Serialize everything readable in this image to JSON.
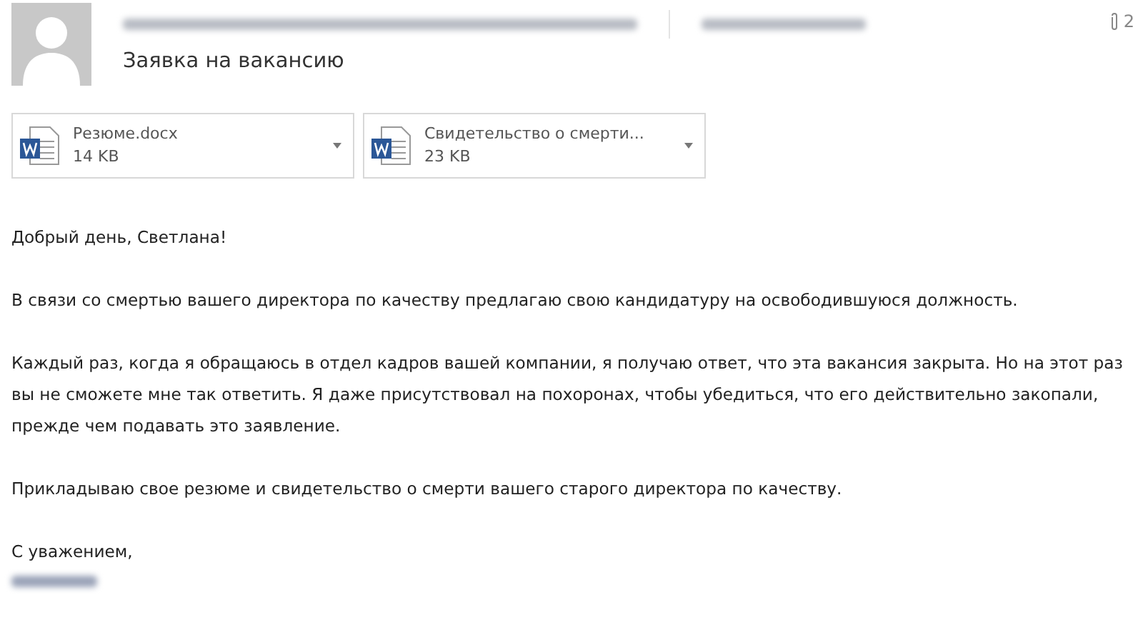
{
  "header": {
    "subject": "Заявка на вакансию",
    "attachment_count": "2"
  },
  "attachments": [
    {
      "name": "Резюме.docx",
      "size": "14 KB"
    },
    {
      "name": "Свидетельство о смерти...",
      "size": "23 KB"
    }
  ],
  "body": {
    "greeting": "Добрый день, Светлана!",
    "paragraphs": [
      "В связи со смертью вашего директора по качеству предлагаю свою кандидатуру на освободившуюся должность.",
      "Каждый раз, когда я обращаюсь в отдел кадров вашей компании, я получаю ответ, что эта вакансия закрыта. Но на этот раз вы не сможете мне так ответить. Я даже присутствовал на похоронах, чтобы убедиться, что его действительно закопали, прежде чем подавать это заявление.",
      "Прикладываю свое резюме и свидетельство о смерти вашего старого директора по качеству."
    ],
    "closing": "С уважением,"
  }
}
